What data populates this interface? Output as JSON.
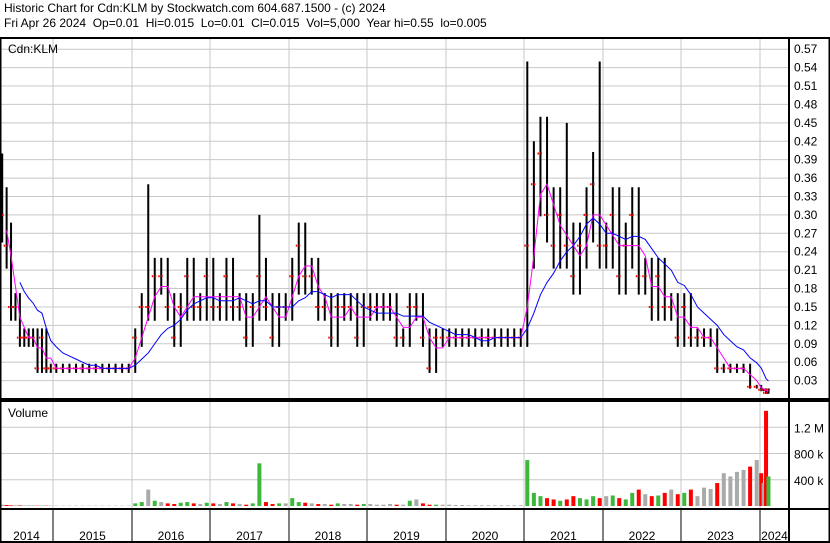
{
  "header": {
    "line1": "Historic Chart for Cdn:KLM by Stockwatch.com 604.687.1500 - (c) 2024",
    "line2": "Fri Apr 26 2024  Op=0.01  Hi=0.015  Lo=0.01  Cl=0.015  Vol=5,000  Year hi=0.55  lo=0.005"
  },
  "chart_data": {
    "type": "bar",
    "title": "Cdn:KLM",
    "price_ticks": [
      0.03,
      0.06,
      0.09,
      0.12,
      0.15,
      0.18,
      0.21,
      0.24,
      0.27,
      0.3,
      0.33,
      0.36,
      0.39,
      0.42,
      0.45,
      0.48,
      0.51,
      0.54,
      0.57
    ],
    "price_tick_labels": [
      "0.03",
      "0.06",
      "0.09",
      "0.12",
      "0.15",
      "0.18",
      "0.21",
      "0.24",
      "0.27",
      "0.30",
      "0.33",
      "0.36",
      "0.39",
      "0.42",
      "0.45",
      "0.48",
      "0.51",
      "0.54",
      "0.57"
    ],
    "ylim": [
      0,
      0.585
    ],
    "volume_label": "Volume",
    "volume_ticks": [
      400,
      800,
      1200
    ],
    "volume_tick_labels": [
      "400 k",
      "800 k",
      "1.2 M"
    ],
    "volume_ylim": [
      0,
      1600
    ],
    "years": [
      "2014",
      "2015",
      "2016",
      "2017",
      "2018",
      "2019",
      "2020",
      "2021",
      "2022",
      "2023",
      "2024"
    ],
    "start_month": "2014-01",
    "monthly_close": [
      0.3,
      0.25,
      0.15,
      0.15,
      0.1,
      0.1,
      0.1,
      0.1,
      0.05,
      0.1,
      0.05,
      0.05,
      0.05,
      0.05,
      0.05,
      0.05,
      0.05,
      0.05,
      0.05,
      0.05,
      0.05,
      0.05,
      0.05,
      0.05,
      0.1,
      0.15,
      0.15,
      0.2,
      0.2,
      0.15,
      0.1,
      0.15,
      0.2,
      0.15,
      0.15,
      0.2,
      0.15,
      0.15,
      0.2,
      0.15,
      0.15,
      0.1,
      0.15,
      0.2,
      0.15,
      0.1,
      0.15,
      0.15,
      0.2,
      0.25,
      0.2,
      0.2,
      0.15,
      0.15,
      0.1,
      0.15,
      0.15,
      0.15,
      0.1,
      0.15,
      0.15,
      0.15,
      0.15,
      0.15,
      0.1,
      0.1,
      0.15,
      0.15,
      0.1,
      0.05,
      0.1,
      0.1,
      0.1,
      0.1,
      0.1,
      0.1,
      0.1,
      0.1,
      0.1,
      0.1,
      0.1,
      0.1,
      0.1,
      0.1,
      0.25,
      0.35,
      0.4,
      0.3,
      0.25,
      0.3,
      0.25,
      0.2,
      0.25,
      0.3,
      0.35,
      0.25,
      0.25,
      0.3,
      0.2,
      0.25,
      0.3,
      0.2,
      0.2,
      0.15,
      0.2,
      0.15,
      0.15,
      0.1,
      0.15,
      0.1,
      0.1,
      0.1,
      0.1,
      0.05,
      0.05,
      0.05,
      0.05,
      0.05,
      0.02,
      0.02,
      0.015,
      0.015,
      0.01,
      0.015
    ],
    "spike_highs": {
      "0": 0.4,
      "26": 0.35,
      "43": 0.3,
      "84": 0.55,
      "90": 0.45,
      "95": 0.55,
      "85": 0.42
    },
    "monthly_volume_k": [
      20,
      15,
      10,
      10,
      8,
      8,
      10,
      8,
      5,
      5,
      5,
      5,
      5,
      5,
      5,
      5,
      5,
      5,
      5,
      5,
      5,
      5,
      5,
      5,
      40,
      60,
      250,
      80,
      60,
      40,
      30,
      50,
      60,
      40,
      30,
      50,
      40,
      30,
      60,
      40,
      30,
      20,
      40,
      650,
      60,
      30,
      40,
      40,
      120,
      60,
      50,
      40,
      30,
      30,
      20,
      40,
      30,
      30,
      20,
      30,
      30,
      20,
      20,
      30,
      20,
      20,
      80,
      100,
      40,
      20,
      20,
      20,
      20,
      15,
      15,
      10,
      10,
      10,
      10,
      10,
      10,
      10,
      10,
      10,
      700,
      200,
      150,
      120,
      100,
      80,
      100,
      150,
      120,
      100,
      150,
      120,
      150,
      160,
      120,
      100,
      200,
      250,
      180,
      150,
      160,
      200,
      250,
      180,
      200,
      250,
      150,
      280,
      260,
      350,
      500,
      450,
      520,
      550,
      600,
      700,
      500,
      350,
      1450,
      450
    ]
  }
}
